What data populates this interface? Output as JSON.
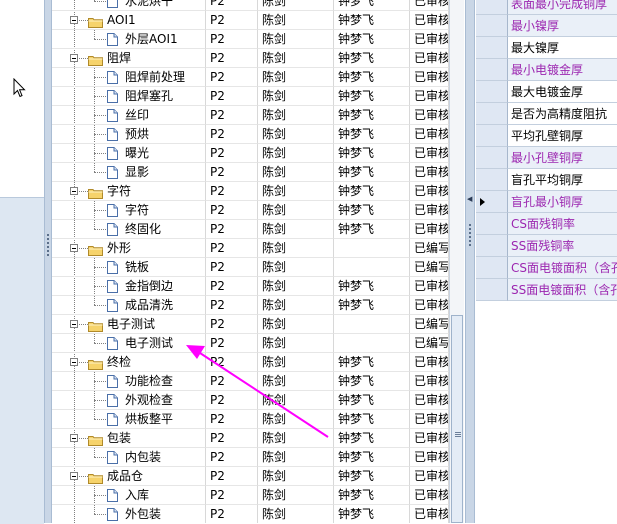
{
  "tree_rows": [
    {
      "label": "水泥烘干",
      "level": 2,
      "type": "doc",
      "ver": "P2",
      "a": "陈剑",
      "b": "钟梦飞",
      "s": "已审核"
    },
    {
      "label": "AOI1",
      "level": 1,
      "type": "folder",
      "ver": "P2",
      "a": "陈剑",
      "b": "钟梦飞",
      "s": "已审核"
    },
    {
      "label": "外层AOI1",
      "level": 2,
      "type": "doc",
      "ver": "P2",
      "a": "陈剑",
      "b": "钟梦飞",
      "s": "已审核"
    },
    {
      "label": "阻焊",
      "level": 1,
      "type": "folder",
      "ver": "P2",
      "a": "陈剑",
      "b": "钟梦飞",
      "s": "已审核"
    },
    {
      "label": "阻焊前处理",
      "level": 2,
      "type": "doc",
      "ver": "P2",
      "a": "陈剑",
      "b": "钟梦飞",
      "s": "已审核"
    },
    {
      "label": "阻焊塞孔",
      "level": 2,
      "type": "doc",
      "ver": "P2",
      "a": "陈剑",
      "b": "钟梦飞",
      "s": "已审核"
    },
    {
      "label": "丝印",
      "level": 2,
      "type": "doc",
      "ver": "P2",
      "a": "陈剑",
      "b": "钟梦飞",
      "s": "已审核"
    },
    {
      "label": "预烘",
      "level": 2,
      "type": "doc",
      "ver": "P2",
      "a": "陈剑",
      "b": "钟梦飞",
      "s": "已审核"
    },
    {
      "label": "曝光",
      "level": 2,
      "type": "doc",
      "ver": "P2",
      "a": "陈剑",
      "b": "钟梦飞",
      "s": "已审核"
    },
    {
      "label": "显影",
      "level": 2,
      "type": "doc",
      "ver": "P2",
      "a": "陈剑",
      "b": "钟梦飞",
      "s": "已审核"
    },
    {
      "label": "字符",
      "level": 1,
      "type": "folder",
      "ver": "P2",
      "a": "陈剑",
      "b": "钟梦飞",
      "s": "已审核"
    },
    {
      "label": "字符",
      "level": 2,
      "type": "doc",
      "ver": "P2",
      "a": "陈剑",
      "b": "钟梦飞",
      "s": "已审核"
    },
    {
      "label": "终固化",
      "level": 2,
      "type": "doc",
      "ver": "P2",
      "a": "陈剑",
      "b": "钟梦飞",
      "s": "已审核"
    },
    {
      "label": "外形",
      "level": 1,
      "type": "folder",
      "ver": "P2",
      "a": "陈剑",
      "b": "",
      "s": "已编写"
    },
    {
      "label": "铣板",
      "level": 2,
      "type": "doc",
      "ver": "P2",
      "a": "陈剑",
      "b": "",
      "s": "已编写"
    },
    {
      "label": "金指倒边",
      "level": 2,
      "type": "doc",
      "ver": "P2",
      "a": "陈剑",
      "b": "钟梦飞",
      "s": "已审核"
    },
    {
      "label": "成品清洗",
      "level": 2,
      "type": "doc",
      "ver": "P2",
      "a": "陈剑",
      "b": "钟梦飞",
      "s": "已审核"
    },
    {
      "label": "电子测试",
      "level": 1,
      "type": "folder",
      "ver": "P2",
      "a": "陈剑",
      "b": "",
      "s": "已编写"
    },
    {
      "label": "电子测试",
      "level": 2,
      "type": "doc",
      "ver": "P2",
      "a": "陈剑",
      "b": "",
      "s": "已编写"
    },
    {
      "label": "终检",
      "level": 1,
      "type": "folder",
      "ver": "P2",
      "a": "陈剑",
      "b": "钟梦飞",
      "s": "已审核"
    },
    {
      "label": "功能检查",
      "level": 2,
      "type": "doc",
      "ver": "P2",
      "a": "陈剑",
      "b": "钟梦飞",
      "s": "已审核"
    },
    {
      "label": "外观检查",
      "level": 2,
      "type": "doc",
      "ver": "P2",
      "a": "陈剑",
      "b": "钟梦飞",
      "s": "已审核"
    },
    {
      "label": "烘板整平",
      "level": 2,
      "type": "doc",
      "ver": "P2",
      "a": "陈剑",
      "b": "钟梦飞",
      "s": "已审核"
    },
    {
      "label": "包装",
      "level": 1,
      "type": "folder",
      "ver": "P2",
      "a": "陈剑",
      "b": "钟梦飞",
      "s": "已审核"
    },
    {
      "label": "内包装",
      "level": 2,
      "type": "doc",
      "ver": "P2",
      "a": "陈剑",
      "b": "钟梦飞",
      "s": "已审核"
    },
    {
      "label": "成品仓",
      "level": 1,
      "type": "folder",
      "ver": "P2",
      "a": "陈剑",
      "b": "钟梦飞",
      "s": "已审核"
    },
    {
      "label": "入库",
      "level": 2,
      "type": "doc",
      "ver": "P2",
      "a": "陈剑",
      "b": "钟梦飞",
      "s": "已审核"
    },
    {
      "label": "外包装",
      "level": 2,
      "type": "doc",
      "ver": "P2",
      "a": "陈剑",
      "b": "钟梦飞",
      "s": "已审核"
    }
  ],
  "property_rows": [
    {
      "label": "表面最小完成铜厚",
      "style": "purple"
    },
    {
      "label": "最小镍厚",
      "style": "purple"
    },
    {
      "label": "最大镍厚",
      "style": "black"
    },
    {
      "label": "最小电镀金厚",
      "style": "purple"
    },
    {
      "label": "最大电镀金厚",
      "style": "black"
    },
    {
      "label": "是否为高精度阻抗",
      "style": "black"
    },
    {
      "label": "平均孔壁铜厚",
      "style": "black"
    },
    {
      "label": "最小孔壁铜厚",
      "style": "purple"
    },
    {
      "label": "盲孔平均铜厚",
      "style": "black"
    },
    {
      "label": "盲孔最小铜厚",
      "style": "purple",
      "current": true
    },
    {
      "label": "CS面残铜率",
      "style": "purple"
    },
    {
      "label": "SS面残铜率",
      "style": "purple"
    },
    {
      "label": "CS面电镀面积（含孔）",
      "style": "purple"
    },
    {
      "label": "SS面电镀面积（含孔）",
      "style": "purple"
    }
  ],
  "colors": {
    "accent_purple": "#9c27b0",
    "arrow_magenta": "#ff00ff",
    "header_blue": "#dfe7f3"
  },
  "icons": {
    "folder": "folder-icon",
    "document": "document-icon",
    "expander": "collapse-icon",
    "cursor": "mouse-cursor-icon",
    "annotation": "annotation-arrow"
  }
}
